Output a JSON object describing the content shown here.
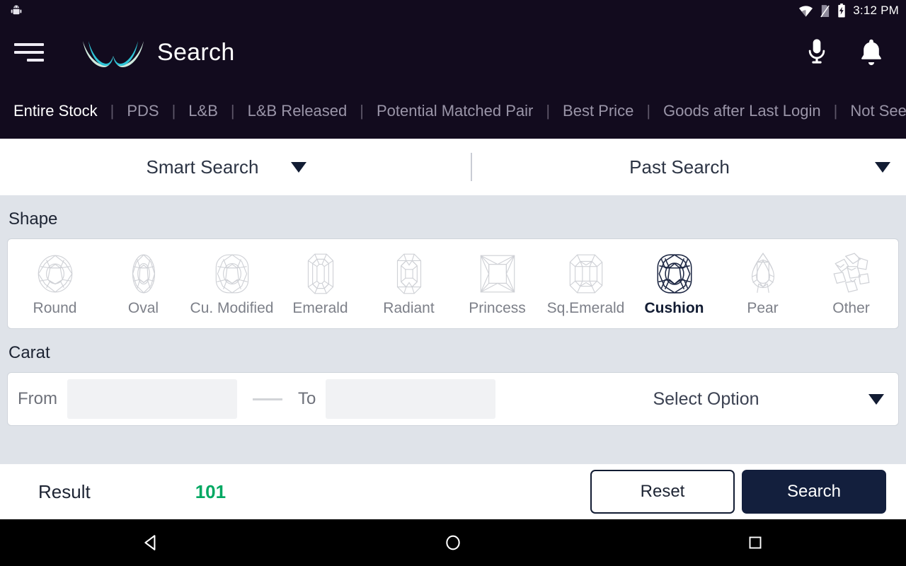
{
  "statusbar": {
    "time": "3:12 PM",
    "icons": {
      "notification": "android-robot-icon",
      "wifi": "wifi-icon",
      "sim": "sim-card-no-signal-icon",
      "battery": "battery-charging-icon"
    }
  },
  "appbar": {
    "menu_icon": "hamburger-menu-icon",
    "logo": "brand-wings-logo",
    "title": "Search",
    "mic_icon": "microphone-icon",
    "bell_icon": "notification-bell-icon"
  },
  "tabs": [
    {
      "label": "Entire Stock",
      "active": true
    },
    {
      "label": "PDS",
      "active": false
    },
    {
      "label": "L&B",
      "active": false
    },
    {
      "label": "L&B Released",
      "active": false
    },
    {
      "label": "Potential Matched Pair",
      "active": false
    },
    {
      "label": "Best Price",
      "active": false
    },
    {
      "label": "Goods after Last Login",
      "active": false
    },
    {
      "label": "Not Seen",
      "active": false
    }
  ],
  "search_modes": {
    "smart": {
      "label": "Smart Search",
      "caret": "chevron-down-icon"
    },
    "past": {
      "label": "Past Search",
      "caret": "chevron-down-icon"
    }
  },
  "shape": {
    "section_label": "Shape",
    "items": [
      {
        "label": "Round",
        "icon": "diamond-round-icon",
        "selected": false
      },
      {
        "label": "Oval",
        "icon": "diamond-oval-icon",
        "selected": false
      },
      {
        "label": "Cu. Modified",
        "icon": "diamond-cushion-modified-icon",
        "selected": false
      },
      {
        "label": "Emerald",
        "icon": "diamond-emerald-icon",
        "selected": false
      },
      {
        "label": "Radiant",
        "icon": "diamond-radiant-icon",
        "selected": false
      },
      {
        "label": "Princess",
        "icon": "diamond-princess-icon",
        "selected": false
      },
      {
        "label": "Sq.Emerald",
        "icon": "diamond-square-emerald-icon",
        "selected": false
      },
      {
        "label": "Cushion",
        "icon": "diamond-cushion-icon",
        "selected": true
      },
      {
        "label": "Pear",
        "icon": "diamond-pear-icon",
        "selected": false
      },
      {
        "label": "Other",
        "icon": "diamond-other-icon",
        "selected": false
      }
    ]
  },
  "carat": {
    "section_label": "Carat",
    "from_label": "From",
    "from_value": "",
    "to_label": "To",
    "to_value": "",
    "select_option_label": "Select Option",
    "select_caret": "chevron-down-icon"
  },
  "actionbar": {
    "result_label": "Result",
    "result_value": "101",
    "reset_label": "Reset",
    "search_label": "Search"
  },
  "navbar": {
    "back": "android-back-triangle-icon",
    "home": "android-home-circle-icon",
    "recents": "android-recents-square-icon"
  },
  "colors": {
    "header_bg": "#120b1e",
    "body_bg": "#dfe3e9",
    "accent_navy": "#131f3d",
    "result_green": "#00a862",
    "logo_teal": "#2ec4d6",
    "logo_mint": "#cfe9dd"
  }
}
